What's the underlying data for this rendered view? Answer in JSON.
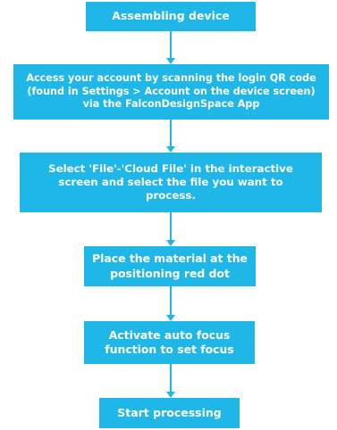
{
  "flowchart": {
    "accent_color": "#1fb6e8",
    "text_color": "#ffffff",
    "steps": [
      {
        "label": "Assembling device"
      },
      {
        "label": "Access your account by scanning the login QR code (found in Settings > Account on the device screen) via the FalconDesignSpace App"
      },
      {
        "label": "Select 'File'-'Cloud File' in the interactive screen and select the file you want to process."
      },
      {
        "label": "Place the material at the positioning red dot"
      },
      {
        "label": "Activate auto focus function to set focus"
      },
      {
        "label": "Start processing"
      }
    ]
  }
}
